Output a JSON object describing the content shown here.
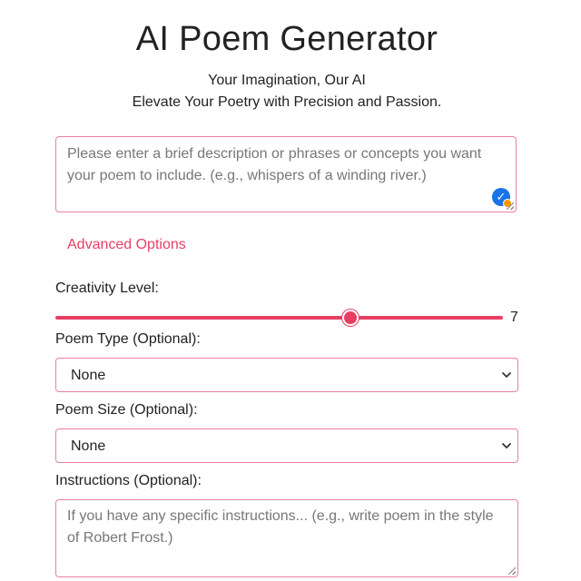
{
  "header": {
    "title": "AI Poem Generator",
    "tagline_1": "Your Imagination, Our AI",
    "tagline_2": "Elevate Your Poetry with Precision and Passion."
  },
  "prompt": {
    "placeholder": "Please enter a brief description or phrases or concepts you want your poem to include. (e.g., whispers of a winding river.)",
    "value": ""
  },
  "advanced": {
    "link_label": "Advanced Options"
  },
  "creativity": {
    "label": "Creativity Level:",
    "value": "7",
    "min": 0,
    "max": 10
  },
  "poem_type": {
    "label": "Poem Type (Optional):",
    "selected": "None"
  },
  "poem_size": {
    "label": "Poem Size (Optional):",
    "selected": "None"
  },
  "instructions": {
    "label": "Instructions (Optional):",
    "placeholder": "If you have any specific instructions... (e.g., write poem in the style of Robert Frost.)",
    "value": ""
  },
  "icons": {
    "grammar_check": "check-circle-icon",
    "select_arrow": "chevron-down-icon",
    "resize": "resize-grip-icon"
  },
  "colors": {
    "accent": "#e83e62",
    "border": "#e8819a",
    "placeholder_text": "#777777",
    "badge_blue": "#1a73e8"
  }
}
